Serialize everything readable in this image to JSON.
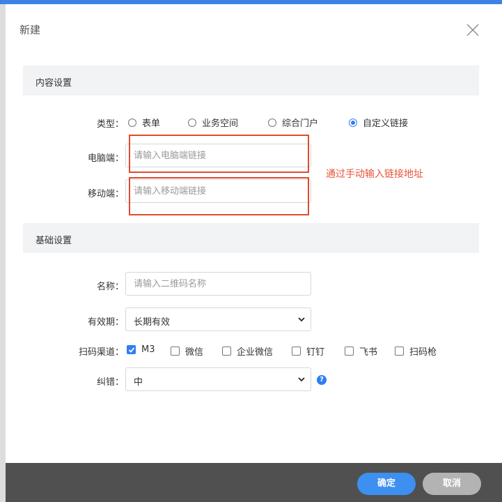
{
  "dialog": {
    "title": "新建"
  },
  "content_section": {
    "title": "内容设置",
    "type_label": "类型：",
    "type_options": [
      {
        "label": "表单",
        "selected": false
      },
      {
        "label": "业务空间",
        "selected": false
      },
      {
        "label": "综合门户",
        "selected": false
      },
      {
        "label": "自定义链接",
        "selected": true
      }
    ],
    "pc_label": "电脑端：",
    "pc_placeholder": "请输入电脑端链接",
    "mobile_label": "移动端：",
    "mobile_placeholder": "请输入移动端链接",
    "annotation": "通过手动输入链接地址"
  },
  "basic_section": {
    "title": "基础设置",
    "name_label": "名称：",
    "name_placeholder": "请输入二维码名称",
    "validity_label": "有效期：",
    "validity_value": "长期有效",
    "channel_label": "扫码渠道：",
    "channels": [
      {
        "label": "M3",
        "checked": true
      },
      {
        "label": "微信",
        "checked": false
      },
      {
        "label": "企业微信",
        "checked": false
      },
      {
        "label": "钉钉",
        "checked": false
      },
      {
        "label": "飞书",
        "checked": false
      },
      {
        "label": "扫码枪",
        "checked": false
      }
    ],
    "error_label": "纠错：",
    "error_value": "中",
    "help_glyph": "?"
  },
  "footer": {
    "ok_label": "确定",
    "cancel_label": "取消"
  },
  "colors": {
    "accent": "#2f7ef2",
    "annotation_red": "#e04a2f",
    "footer_bg": "#505050"
  }
}
